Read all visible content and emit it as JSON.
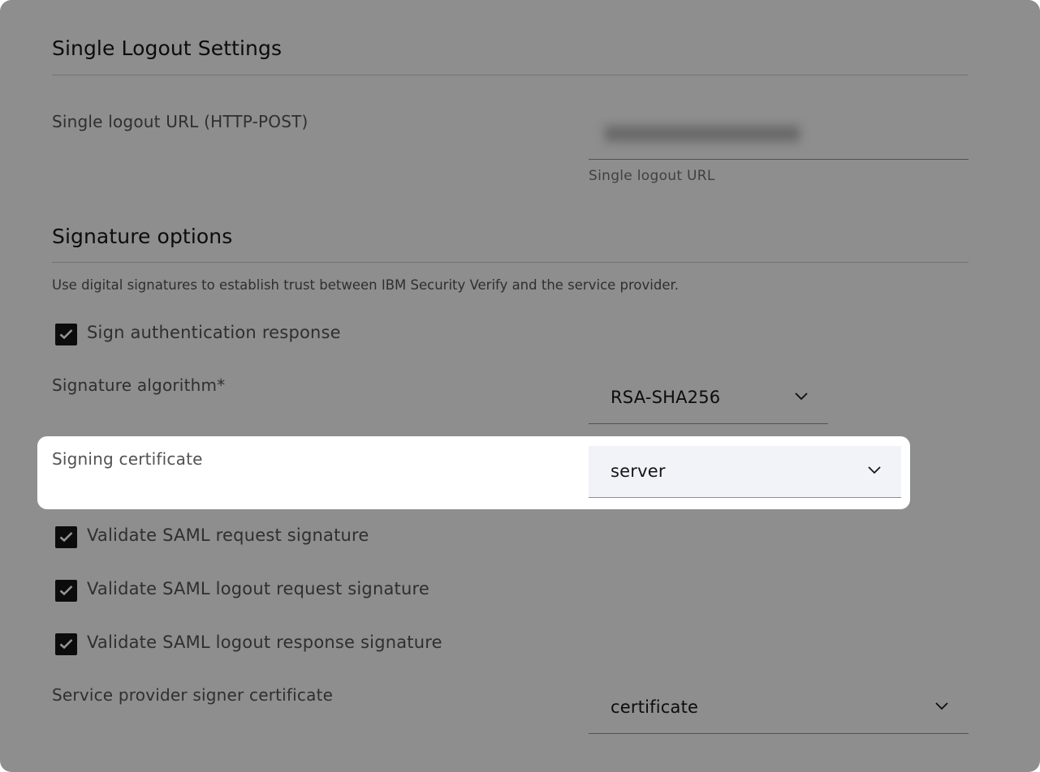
{
  "single_logout": {
    "title": "Single Logout Settings",
    "url_label": "Single logout URL (HTTP-POST)",
    "url_helper": "Single logout URL"
  },
  "signature": {
    "title": "Signature options",
    "description": "Use digital signatures to establish trust between IBM Security Verify and the service provider.",
    "sign_auth_response": {
      "label": "Sign authentication response",
      "checked": true
    },
    "algorithm_label": "Signature algorithm*",
    "algorithm_value": "RSA-SHA256",
    "signing_cert_label": "Signing certificate",
    "signing_cert_value": "server",
    "validate_request": {
      "label": "Validate SAML request signature",
      "checked": true
    },
    "validate_logout_request": {
      "label": "Validate SAML logout request signature",
      "checked": true
    },
    "validate_logout_response": {
      "label": "Validate SAML logout response signature",
      "checked": true
    },
    "sp_cert_label": "Service provider signer certificate",
    "sp_cert_value": "certificate"
  },
  "icons": {
    "dropdown": "chevron-down-icon",
    "checkbox": "checkmark-icon"
  },
  "colors": {
    "checkbox_fill": "#161616",
    "overlay": "rgba(0,0,0,0.42)",
    "field_bg": "#f4f4f4"
  }
}
